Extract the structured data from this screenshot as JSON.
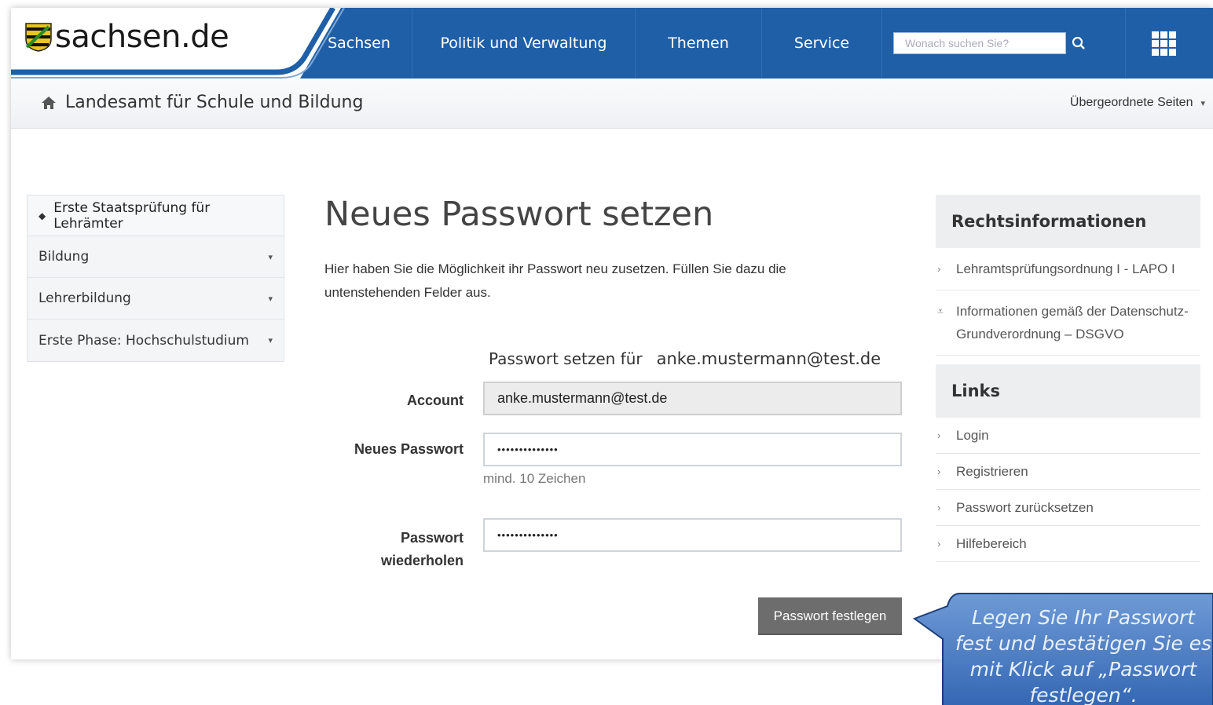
{
  "header": {
    "brand": "sachsen.de",
    "nav": [
      "Sachsen",
      "Politik und Verwaltung",
      "Themen",
      "Service"
    ],
    "search_placeholder": "Wonach suchen Sie?",
    "brand_blue": "#1f5fa8"
  },
  "subbar": {
    "site_title": "Landesamt für Schule und Bildung",
    "parents_label": "Übergeordnete Seiten"
  },
  "leftnav": {
    "head": "Erste Staatsprüfung für Lehrämter",
    "items": [
      "Bildung",
      "Lehrerbildung",
      "Erste Phase: Hochschulstudium"
    ]
  },
  "main": {
    "title": "Neues Passwort setzen",
    "intro": "Hier haben Sie die Möglichkeit ihr Passwort neu zusetzen. Füllen Sie dazu die untenstehenden Felder aus.",
    "form": {
      "for_label": "Passwort setzen für",
      "for_value": "anke.mustermann@test.de",
      "account_label": "Account",
      "account_value": "anke.mustermann@test.de",
      "new_pw_label": "Neues Passwort",
      "new_pw_value": "••••••••••••••",
      "new_pw_hint": "mind. 10 Zeichen",
      "repeat_label_1": "Passwort",
      "repeat_label_2": "wiederholen",
      "repeat_value": "••••••••••••••",
      "submit": "Passwort festlegen"
    }
  },
  "sidebar": {
    "legal_head": "Rechtsinformationen",
    "legal_items": [
      "Lehramtsprüfungsordnung I - LAPO I",
      "Informationen gemäß der Datenschutz-Grundverordnung – DSGVO"
    ],
    "links_head": "Links",
    "links": [
      "Login",
      "Registrieren",
      "Passwort zurücksetzen",
      "Hilfebereich"
    ]
  },
  "callout": {
    "text": "Legen Sie Ihr Passwort fest und bestätigen Sie es mit Klick auf „Passwort festlegen“."
  }
}
